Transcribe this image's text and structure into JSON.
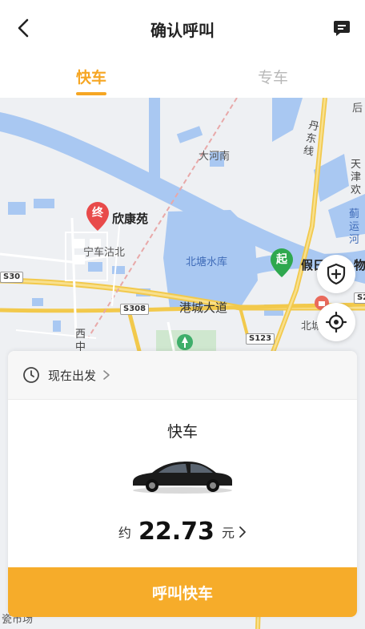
{
  "header": {
    "title": "确认呼叫"
  },
  "tabs": [
    {
      "label": "快车",
      "active": true
    },
    {
      "label": "专车",
      "active": false
    }
  ],
  "map": {
    "labels": {
      "dahenan": "大河南",
      "beitang": "北塘水库",
      "gangcheng": "港城大道",
      "ningche": "宁车沽北",
      "xinkang": "欣康苑",
      "dandong": "丹东线",
      "jiari": "假日",
      "wu": "物",
      "beicheng": "北城",
      "xizhong": "西中",
      "hou": "后",
      "tianjin": "天津欢",
      "jiyunhe": "蓟运河",
      "dong": "东",
      "market": "瓷市场"
    },
    "road_signs": {
      "s30": "S30",
      "s308": "S308",
      "s123": "S123",
      "s2": "S2"
    },
    "pins": {
      "end": "终",
      "start": "起"
    }
  },
  "card": {
    "depart_label": "现在出发",
    "car_type": "快车",
    "price_prefix": "约",
    "price": "22.73",
    "price_unit": "元"
  },
  "call_button": "呼叫快车",
  "colors": {
    "accent": "#f6a623",
    "button": "#f6ac2a",
    "start_pin": "#2fa84f",
    "end_pin": "#e84a4a"
  }
}
